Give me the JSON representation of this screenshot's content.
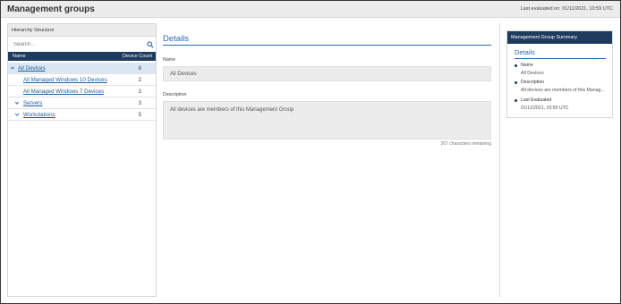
{
  "header": {
    "title": "Management groups",
    "last_evaluated": "Last evaluated on: 01/11/2021, 10:59 UTC"
  },
  "hierarchy": {
    "title": "Hierarchy Structure",
    "search_placeholder": "Search...",
    "columns": {
      "name": "Name",
      "count": "Device Count"
    },
    "rows": [
      {
        "label": "All Devices",
        "count": "8"
      },
      {
        "label": "All Managed Windows 10 Devices",
        "count": "2"
      },
      {
        "label": "All Managed Windows 7 Devices",
        "count": "3"
      },
      {
        "label": "Servers",
        "count": "3"
      },
      {
        "label": "Workstations",
        "count": "5"
      }
    ]
  },
  "details": {
    "title": "Details",
    "name_label": "Name",
    "name_value": "All Devices",
    "description_label": "Description",
    "description_value": "All devices are members of this Management Group",
    "chars_remaining": "207 characters remaining"
  },
  "summary": {
    "header": "Management Group Summary",
    "subtitle": "Details",
    "items": [
      {
        "label": "Name",
        "value": "All Devices"
      },
      {
        "label": "Description",
        "value": "All devices are members of this Manag..."
      },
      {
        "label": "Last Evaluated",
        "value": "01/11/2021, 10:59 UTC"
      }
    ]
  },
  "colors": {
    "accent": "#2a6ab0",
    "navy": "#1f3b5e",
    "selected_row": "#dbe8f4"
  },
  "icons": {
    "search": "search-icon",
    "expand": "chevron-down-icon"
  }
}
